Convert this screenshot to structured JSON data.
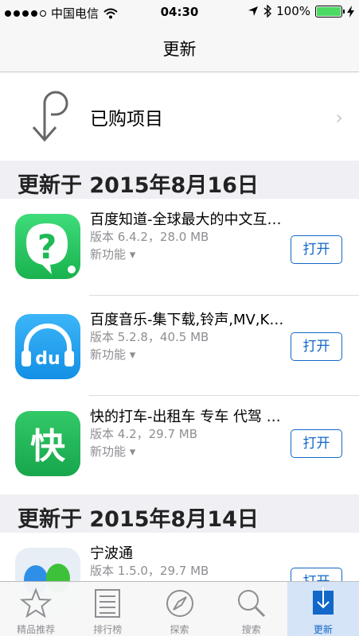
{
  "status_bar": {
    "carrier": "中国电信",
    "time": "04:30",
    "battery_pct": "100%",
    "battery_level": 1.0,
    "battery_color": "#4cd964"
  },
  "nav": {
    "title": "更新"
  },
  "purchased": {
    "label": "已购项目",
    "icon": "purchased-arrow-icon"
  },
  "sections": [
    {
      "header": "更新于 2015年8月16日"
    },
    {
      "header": "更新于 2015年8月14日"
    }
  ],
  "apps": [
    {
      "name": "百度知道-全球最大的中文互动问答平台",
      "version": "版本 6.4.2，28.0 MB",
      "whats_new": "新功能 ▾",
      "button": "打开",
      "icon": "baidu-zhidao-icon"
    },
    {
      "name": "百度音乐-集下载,铃声,MV,K歌于一体",
      "version": "版本 5.2.8，40.5 MB",
      "whats_new": "新功能 ▾",
      "button": "打开",
      "icon": "baidu-music-icon"
    },
    {
      "name": "快的打车-出租车 专车 代驾 顺风车",
      "version": "版本 4.2，29.7 MB",
      "whats_new": "新功能 ▾",
      "button": "打开",
      "icon": "kuaidi-taxi-icon"
    },
    {
      "name": "宁波通",
      "version": "版本 1.5.0，29.7 MB",
      "whats_new": "",
      "button": "打开",
      "icon": "ningbotong-icon"
    }
  ],
  "tabs": [
    {
      "label": "精品推荐",
      "icon": "star-icon"
    },
    {
      "label": "排行榜",
      "icon": "list-icon"
    },
    {
      "label": "探索",
      "icon": "compass-icon"
    },
    {
      "label": "搜索",
      "icon": "search-icon"
    },
    {
      "label": "更新",
      "icon": "updates-icon",
      "active": true
    }
  ],
  "colors": {
    "accent": "#1268c8",
    "active_tab_bg": "#d6e4f7",
    "section_bg": "#efeff4"
  }
}
